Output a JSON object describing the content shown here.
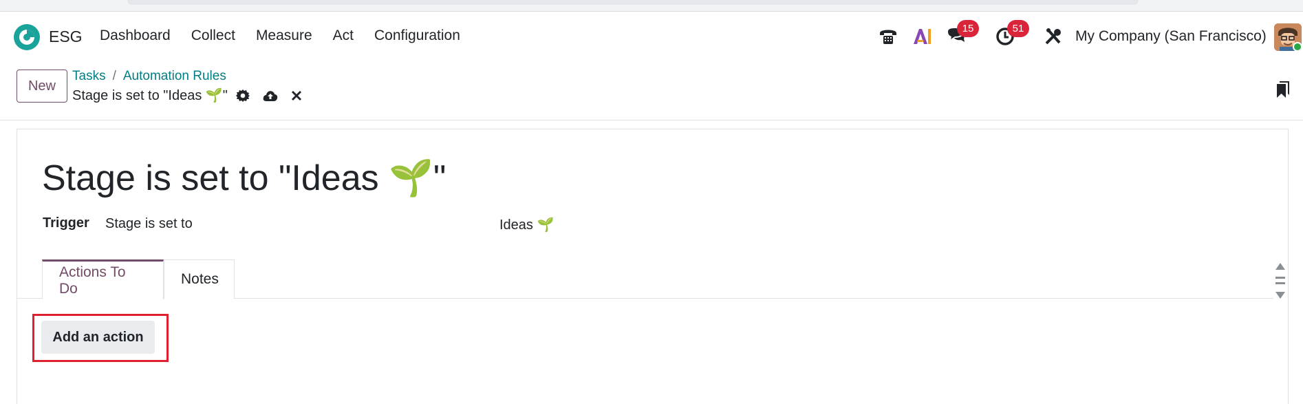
{
  "navbar": {
    "app_name": "ESG",
    "menu": [
      "Dashboard",
      "Collect",
      "Measure",
      "Act",
      "Configuration"
    ],
    "messages_badge": "15",
    "activities_badge": "51",
    "company": "My Company (San Francisco)",
    "icons": [
      "phone-icon",
      "ai-icon",
      "chat-icon",
      "clock-icon",
      "tools-icon"
    ]
  },
  "control": {
    "new_label": "New",
    "breadcrumb": [
      "Tasks",
      "Automation Rules"
    ],
    "breadcrumb_sep": "/",
    "record_name": "Stage is set to \"Ideas 🌱\""
  },
  "form": {
    "title": "Stage is set to \"Ideas 🌱\"",
    "trigger_label": "Trigger",
    "trigger_value": "Stage is set to",
    "trigger_stage": "Ideas 🌱"
  },
  "tabs": [
    "Actions To Do",
    "Notes"
  ],
  "add_action_label": "Add an action",
  "colors": {
    "brand": "#714b67",
    "link": "#017e84",
    "badge": "#d9243a",
    "highlight": "#e0202e"
  }
}
